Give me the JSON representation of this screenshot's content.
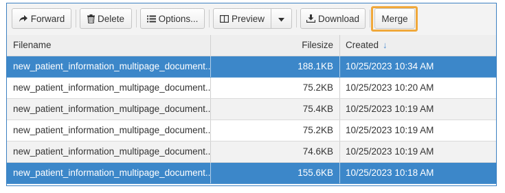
{
  "toolbar": {
    "forward_label": "Forward",
    "delete_label": "Delete",
    "options_label": "Options...",
    "preview_label": "Preview",
    "download_label": "Download",
    "merge_label": "Merge"
  },
  "colors": {
    "accent": "#3c87c9",
    "highlight": "#f0a83a"
  },
  "table": {
    "columns": [
      "Filename",
      "Filesize",
      "Created"
    ],
    "sort_indicator": "↓",
    "rows": [
      {
        "filename": "new_patient_information_multipage_document...",
        "filesize": "188.1KB",
        "created": "10/25/2023 10:34 AM",
        "selected": true
      },
      {
        "filename": "new_patient_information_multipage_document...",
        "filesize": "75.2KB",
        "created": "10/25/2023 10:20 AM",
        "selected": false
      },
      {
        "filename": "new_patient_information_multipage_document...",
        "filesize": "75.4KB",
        "created": "10/25/2023 10:19 AM",
        "selected": false
      },
      {
        "filename": "new_patient_information_multipage_document...",
        "filesize": "75.2KB",
        "created": "10/25/2023 10:19 AM",
        "selected": false
      },
      {
        "filename": "new_patient_information_multipage_document...",
        "filesize": "74.6KB",
        "created": "10/25/2023 10:19 AM",
        "selected": false
      },
      {
        "filename": "new_patient_information_multipage_document....",
        "filesize": "155.6KB",
        "created": "10/25/2023 10:18 AM",
        "selected": true
      }
    ]
  }
}
